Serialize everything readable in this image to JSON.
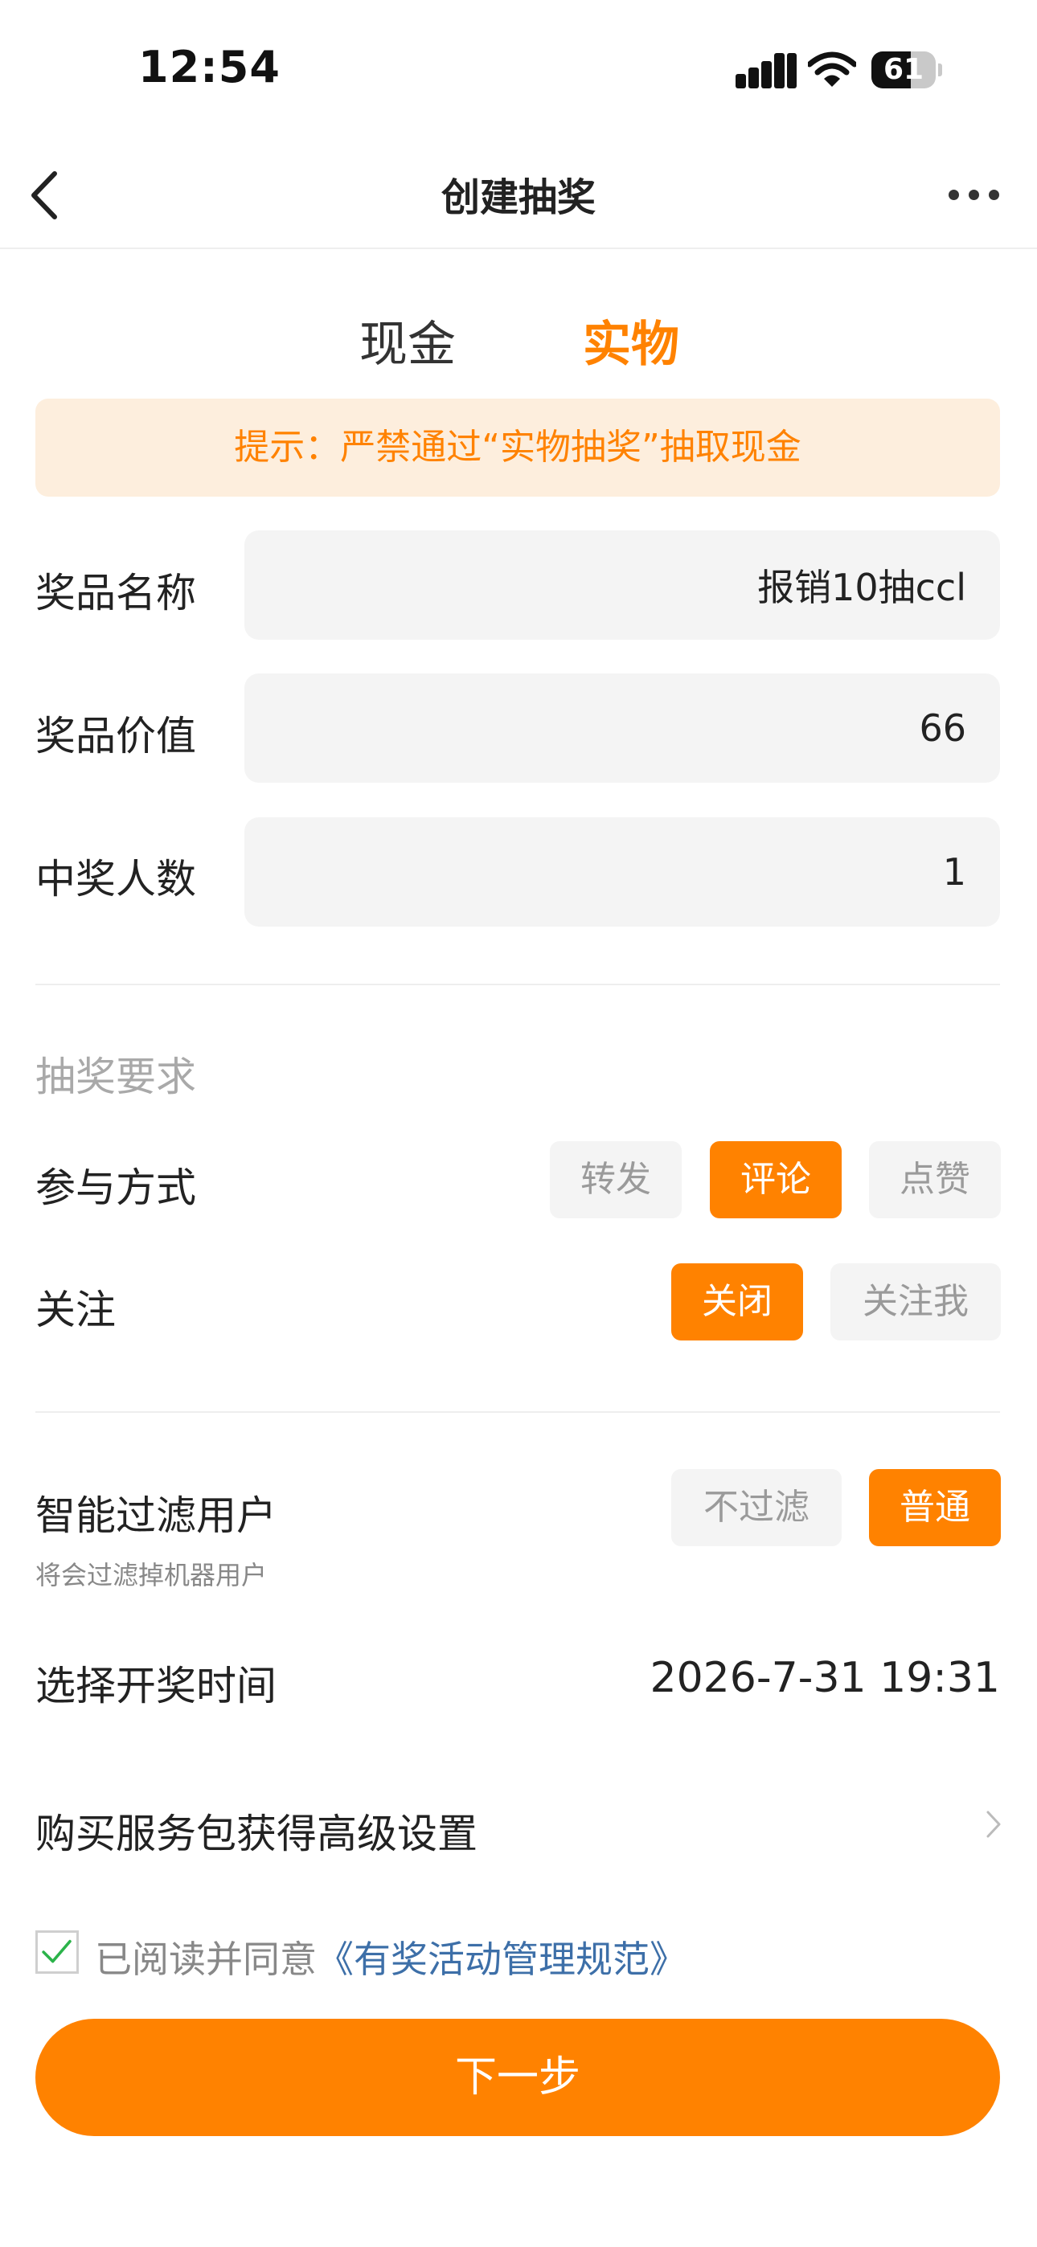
{
  "status_bar": {
    "time": "12:54",
    "battery": "61"
  },
  "nav": {
    "title": "创建抽奖"
  },
  "tabs": [
    {
      "label": "现金",
      "active": false
    },
    {
      "label": "实物",
      "active": true
    }
  ],
  "tip": {
    "text": "提示：严禁通过“实物抽奖”抽取现金"
  },
  "form": {
    "prize_name": {
      "label": "奖品名称",
      "value": "报销10抽ccl"
    },
    "prize_value": {
      "label": "奖品价值",
      "value": "66"
    },
    "winner_count": {
      "label": "中奖人数",
      "value": "1"
    }
  },
  "requirements": {
    "title": "抽奖要求",
    "participation": {
      "label": "参与方式",
      "options": [
        {
          "label": "转发",
          "selected": false
        },
        {
          "label": "评论",
          "selected": true
        },
        {
          "label": "点赞",
          "selected": false
        }
      ]
    },
    "follow": {
      "label": "关注",
      "options": [
        {
          "label": "关闭",
          "selected": true
        },
        {
          "label": "关注我",
          "selected": false
        }
      ]
    }
  },
  "filter": {
    "label": "智能过滤用户",
    "hint": "将会过滤掉机器用户",
    "options": [
      {
        "label": "不过滤",
        "selected": false
      },
      {
        "label": "普通",
        "selected": true
      }
    ]
  },
  "draw_time": {
    "label": "选择开奖时间",
    "value": "2026-7-31 19:31"
  },
  "advanced": {
    "label": "购买服务包获得高级设置"
  },
  "agreement": {
    "checked": true,
    "prefix": "已阅读并同意",
    "link": "《有奖活动管理规范》"
  },
  "next_button": {
    "label": "下一步"
  },
  "colors": {
    "accent": "#ff8200",
    "tip_bg": "#fdeedd",
    "link": "#3d6fa8"
  }
}
